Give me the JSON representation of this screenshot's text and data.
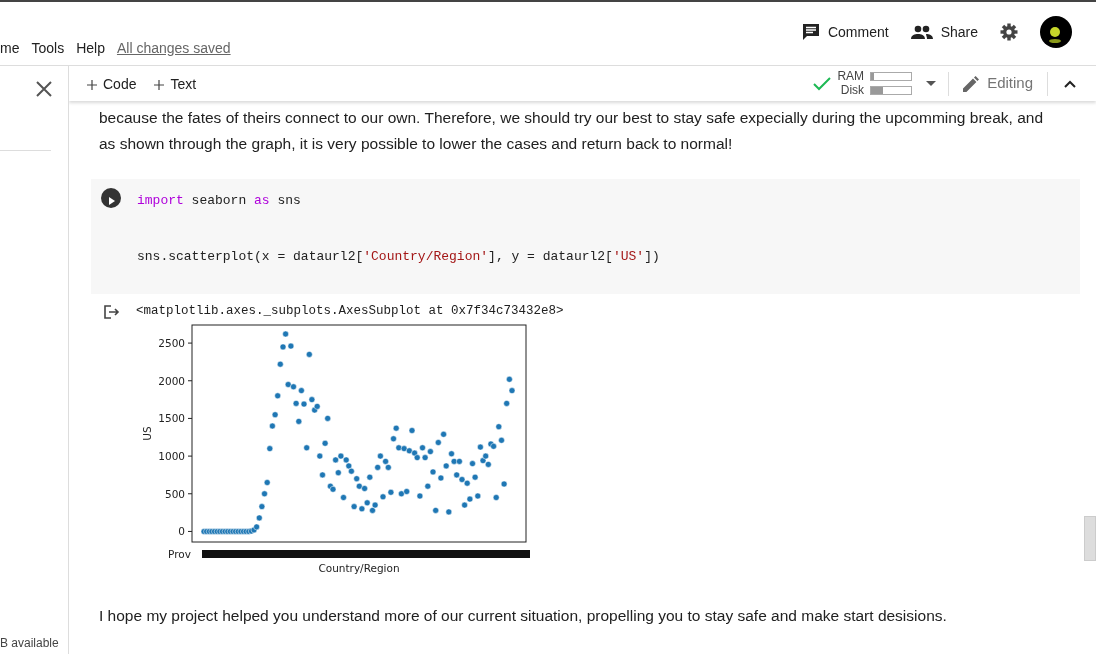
{
  "menu": [
    "me",
    "Tools",
    "Help"
  ],
  "save_status": "All changes saved",
  "header_actions": [
    {
      "kind": "comment",
      "label": "Comment"
    },
    {
      "kind": "share",
      "label": "Share"
    },
    {
      "kind": "settings"
    }
  ],
  "toolbar": {
    "add_buttons": [
      "Code",
      "Text"
    ],
    "ram": {
      "label": "RAM",
      "level": 0.08
    },
    "disk": {
      "label": "Disk",
      "level": 0.3
    },
    "mode": "Editing"
  },
  "sidebar": {
    "footer": "B available"
  },
  "paragraph_top": "because the fates of theirs connect to our own. Therefore, we should try our best to stay safe expecially during the upcomming break, and as shown through the graph, it is very possible to lower the cases and return back to normal!",
  "code_cell": {
    "lines": [
      [
        {
          "kind": "keyword",
          "text": "import"
        },
        {
          "kind": "plain",
          "text": " seaborn "
        },
        {
          "kind": "keyword",
          "text": "as"
        },
        {
          "kind": "plain",
          "text": " sns"
        }
      ],
      [
        {
          "kind": "plain",
          "text": "sns.scatterplot(x = dataurl2["
        },
        {
          "kind": "string",
          "text": "'Country/Region'"
        },
        {
          "kind": "plain",
          "text": "], y = dataurl2["
        },
        {
          "kind": "string",
          "text": "'US'"
        },
        {
          "kind": "plain",
          "text": "])"
        }
      ]
    ]
  },
  "output": {
    "repr": "<matplotlib.axes._subplots.AxesSubplot at 0x7f34c73432e8>",
    "plot": {
      "kind": "picture",
      "ylabel": "US",
      "xlabel": "Country/Region",
      "y_tick_labels": [
        "2500",
        "2000",
        "1500",
        "1000",
        "500",
        "0"
      ],
      "clipped_tick_label": "Prov"
    }
  },
  "paragraph_bottom": "I hope my project helped you understand more of our current situation, propelling you to stay safe and make start desisions."
}
